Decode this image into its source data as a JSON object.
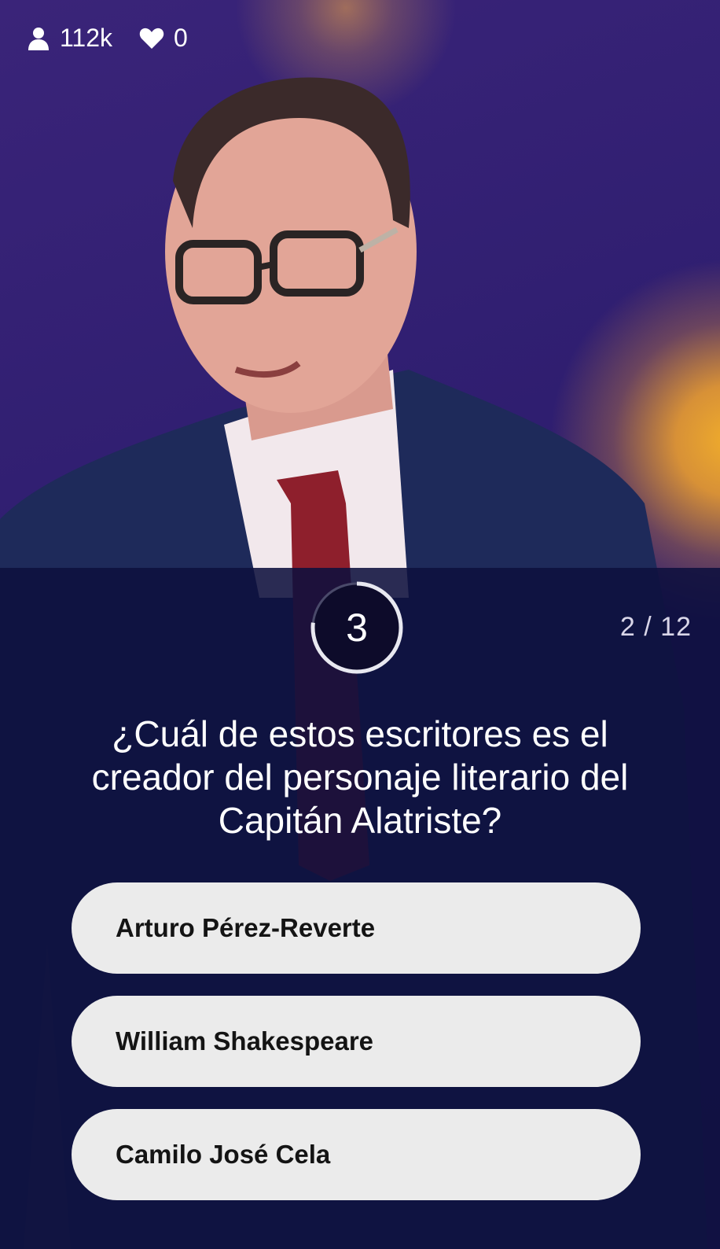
{
  "stats": {
    "viewers": "112k",
    "likes": "0"
  },
  "quiz": {
    "countdown": "3",
    "progress": "2 / 12",
    "question": "¿Cuál de estos escritores es el creador del personaje literario del Capitán Alatriste?",
    "answers": [
      {
        "label": "Arturo Pérez-Reverte"
      },
      {
        "label": "William Shakespeare"
      },
      {
        "label": "Camilo José Cela"
      }
    ]
  },
  "icons": {
    "viewers": "person-icon",
    "likes": "heart-icon"
  },
  "colors": {
    "background": "#2f1e70",
    "panel": "#0e103e",
    "answer_bg": "#ebebeb",
    "accent_glow": "#f5a83a"
  }
}
